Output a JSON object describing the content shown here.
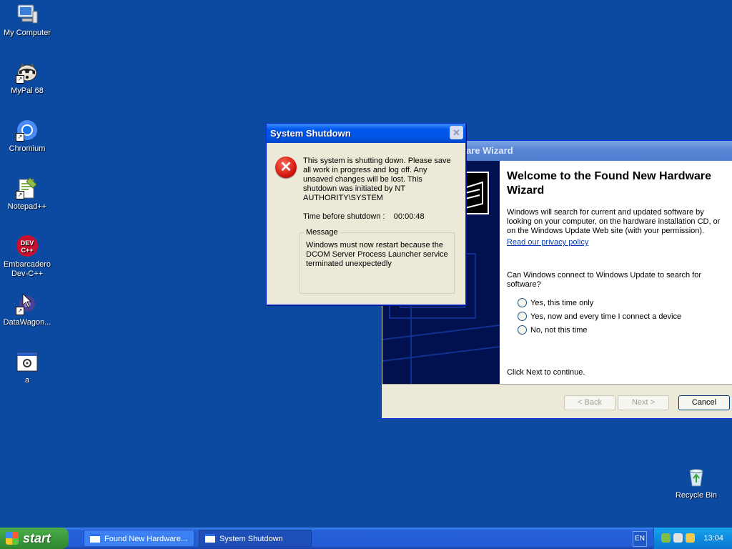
{
  "desktop": {
    "icons": [
      {
        "label": "My Computer"
      },
      {
        "label": "MyPal 68"
      },
      {
        "label": "Chromium"
      },
      {
        "label": "Notepad++"
      },
      {
        "label": "Embarcadero Dev-C++"
      },
      {
        "label": "DataWagon..."
      },
      {
        "label": "a"
      },
      {
        "label": "Recycle Bin"
      }
    ]
  },
  "wizard": {
    "title": "Found New Hardware Wizard",
    "title_visible": "are Wizard",
    "heading": "Welcome to the Found New Hardware Wizard",
    "intro": "Windows will search for current and updated software by looking on your computer, on the hardware installation CD, or on the Windows Update Web site (with your permission).",
    "privacy_link": "Read our privacy policy",
    "question": "Can Windows connect to Windows Update to search for software?",
    "options": [
      {
        "label": "Yes, this time only"
      },
      {
        "label": "Yes, now and every time I connect a device"
      },
      {
        "label": "No, not this time"
      }
    ],
    "continue_text": "Click Next to continue.",
    "back_label": "< Back",
    "next_label": "Next >",
    "cancel_label": "Cancel"
  },
  "shutdown": {
    "title": "System Shutdown",
    "close_label": "✕",
    "message": "This system is shutting down. Please save all work in progress and log off. Any unsaved changes will be lost. This shutdown was initiated by NT AUTHORITY\\SYSTEM",
    "timer_label": "Time before shutdown :",
    "timer_value": "00:00:48",
    "group_label": "Message",
    "group_text": "Windows must now restart because the DCOM Server Process Launcher service terminated unexpectedly"
  },
  "taskbar": {
    "start_label": "start",
    "tasks": [
      {
        "label": "Found New Hardware..."
      },
      {
        "label": "System Shutdown"
      }
    ],
    "lang": "EN",
    "clock": "13:04"
  },
  "colors": {
    "desktop": "#0b4aa0",
    "titlebar_active": "#0055e5",
    "titlebar_inactive": "#7ea6e6",
    "error_red": "#d0140b"
  }
}
